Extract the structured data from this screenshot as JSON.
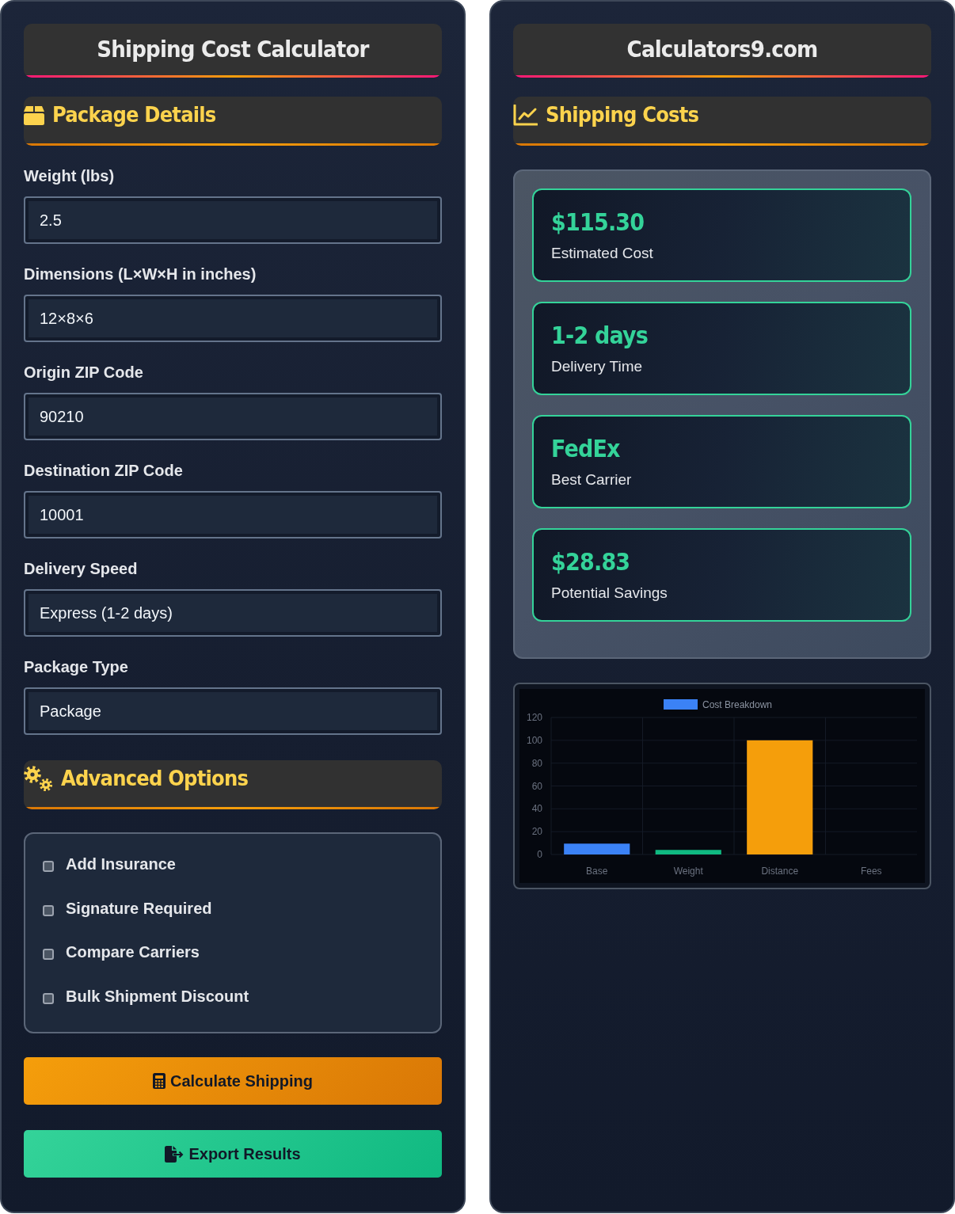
{
  "calculator": {
    "title": "Shipping Cost Calculator",
    "package_section": {
      "heading": "Package Details"
    },
    "fields": [
      {
        "label": "Weight (lbs)",
        "value": "2.5"
      },
      {
        "label": "Dimensions (L×W×H in inches)",
        "value": "12×8×6"
      },
      {
        "label": "Origin ZIP Code",
        "value": "90210"
      },
      {
        "label": "Destination ZIP Code",
        "value": "10001"
      },
      {
        "label": "Delivery Speed",
        "value": "Express (1-2 days)"
      },
      {
        "label": "Package Type",
        "value": "Package"
      }
    ],
    "advanced_section": {
      "heading": "Advanced Options"
    },
    "options": [
      {
        "label": "Add Insurance",
        "checked": false
      },
      {
        "label": "Signature Required",
        "checked": false
      },
      {
        "label": "Compare Carriers",
        "checked": false
      },
      {
        "label": "Bulk Shipment Discount",
        "checked": false
      }
    ],
    "buttons": [
      {
        "label": "Calculate Shipping",
        "kind": "calculate"
      },
      {
        "label": "Export Results",
        "kind": "export"
      }
    ]
  },
  "results_panel": {
    "title": "Calculators9.com",
    "heading": "Shipping Costs",
    "cards": [
      {
        "value": "$115.30",
        "label": "Estimated Cost"
      },
      {
        "value": "1-2 days",
        "label": "Delivery Time"
      },
      {
        "value": "FedEx",
        "label": "Best Carrier"
      },
      {
        "value": "$28.83",
        "label": "Potential Savings"
      }
    ],
    "chart_data": {
      "type": "bar",
      "categories": [
        "Base",
        "Weight",
        "Distance",
        "Fees"
      ],
      "series": [
        {
          "name": "Cost Breakdown",
          "color": "#3b82f6",
          "values": [
            9.5,
            4,
            100,
            0
          ],
          "colors": [
            "#3b82f6",
            "#10b981",
            "#f59e0b",
            null
          ]
        }
      ],
      "ylim": [
        0,
        120
      ],
      "yticks": [
        0,
        20,
        40,
        60,
        80,
        100,
        120
      ],
      "grid": true
    }
  }
}
